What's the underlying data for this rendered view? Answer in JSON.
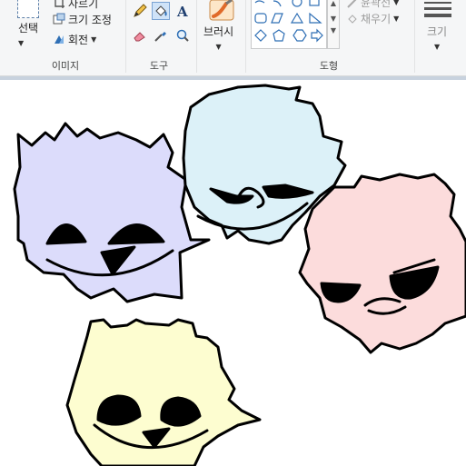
{
  "ribbon": {
    "image_group": {
      "label": "이미지",
      "select_label": "선택",
      "crop_label": "자르기",
      "resize_label": "크기 조정",
      "rotate_label": "회전"
    },
    "tools_group": {
      "label": "도구"
    },
    "brushes": {
      "label": "브러시"
    },
    "shapes_group": {
      "label": "도형",
      "outline_label": "윤곽선",
      "fill_label": "채우기"
    },
    "size": {
      "label": "크기"
    }
  },
  "colors": {
    "accent": "#7aa3d3",
    "purple_face": "#dcdcfb",
    "blue_face": "#dcf1f8",
    "pink_face": "#fcdcdc",
    "yellow_face": "#fdfdd0"
  },
  "icons": [
    "pencil-icon",
    "fill-icon",
    "text-icon",
    "eraser-icon",
    "color-picker-icon",
    "magnifier-icon",
    "crop-icon",
    "resize-icon",
    "rotate-icon",
    "brush-icon"
  ]
}
